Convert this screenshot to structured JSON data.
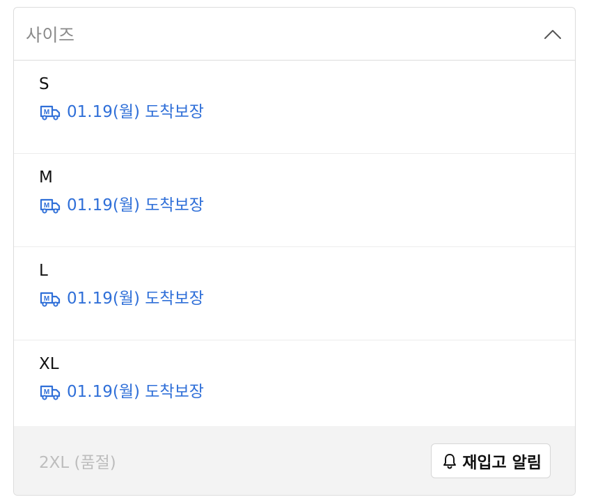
{
  "dropdown": {
    "title": "사이즈",
    "expanded": true,
    "icons": {
      "toggle": "chevron-up-icon",
      "delivery": "delivery-truck-icon",
      "restock": "bell-icon"
    },
    "colors": {
      "delivery_text": "#2f6fd8",
      "soldout_text": "#bdbdbd",
      "soldout_bg": "#f3f3f3"
    },
    "options": [
      {
        "size": "S",
        "delivery": "01.19(월) 도착보장"
      },
      {
        "size": "M",
        "delivery": "01.19(월) 도착보장"
      },
      {
        "size": "L",
        "delivery": "01.19(월) 도착보장"
      },
      {
        "size": "XL",
        "delivery": "01.19(월) 도착보장"
      }
    ],
    "soldout_option": {
      "label": "2XL (품절)",
      "restock_button": "재입고 알림"
    }
  }
}
